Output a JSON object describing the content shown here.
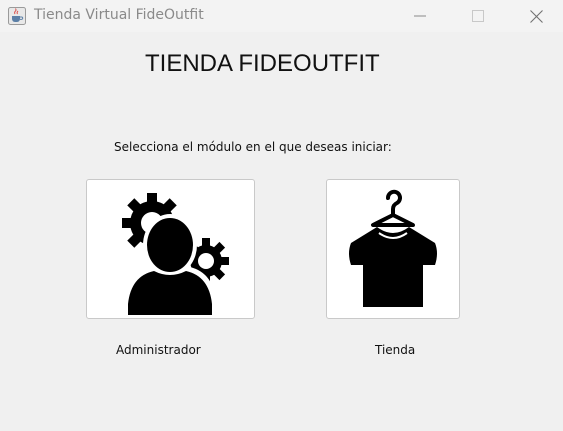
{
  "window": {
    "title": "Tienda Virtual FideOutfit",
    "app_icon": "java-cup-icon",
    "controls": {
      "minimize_icon": "minimize-icon",
      "maximize_icon": "maximize-icon",
      "close_icon": "close-icon"
    }
  },
  "main": {
    "heading": "TIENDA FIDEOUTFIT",
    "prompt": "Selecciona el módulo en el que deseas iniciar:",
    "modules": [
      {
        "label": "Administrador",
        "icon": "admin-user-gears-icon"
      },
      {
        "label": "Tienda",
        "icon": "tshirt-hanger-icon"
      }
    ]
  },
  "colors": {
    "background": "#f0f0f0",
    "titlebar": "#f3f3f3",
    "title_text": "#8a8a8a",
    "icon_fill": "#000000",
    "button_bg": "#ffffff",
    "button_border": "#c9c9c9"
  }
}
